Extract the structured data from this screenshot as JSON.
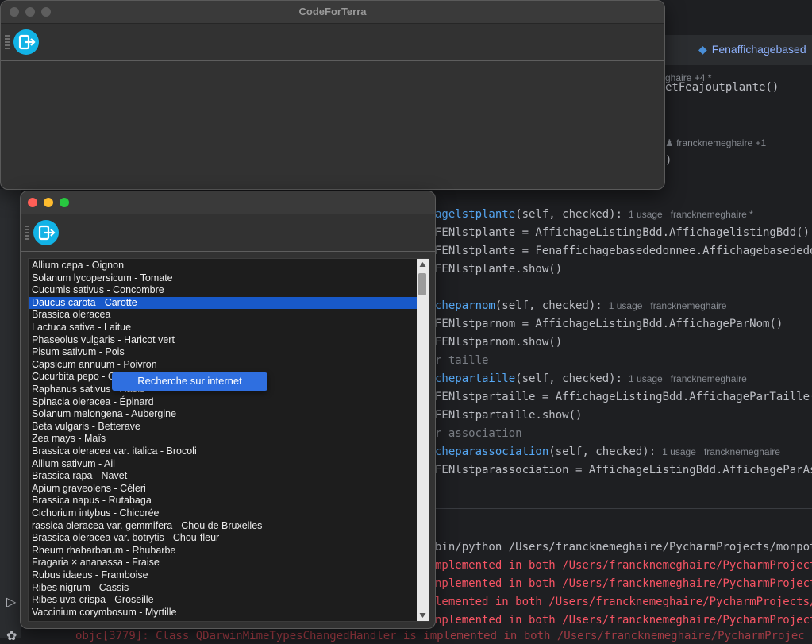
{
  "main_window": {
    "title": "CodeForTerra"
  },
  "list_window": {
    "items": [
      "Allium cepa - Oignon",
      "Solanum lycopersicum - Tomate",
      "Cucumis sativus - Concombre",
      "Daucus carota - Carotte",
      "Brassica oleracea",
      "Lactuca sativa - Laitue",
      "Phaseolus vulgaris - Haricot vert",
      "Pisum sativum - Pois",
      "Capsicum annuum - Poivron",
      "Cucurbita pepo - Courgette",
      "Raphanus sativus - Radis",
      "Spinacia oleracea - Épinard",
      "Solanum melongena - Aubergine",
      "Beta vulgaris - Betterave",
      "Zea mays - Maïs",
      "Brassica oleracea var. italica - Brocoli",
      "Allium sativum - Ail",
      "Brassica rapa - Navet",
      "Apium graveolens - Céleri",
      "Brassica napus - Rutabaga",
      "Cichorium intybus - Chicorée",
      "rassica oleracea var. gemmifera - Chou de Bruxelles",
      "Brassica oleracea var. botrytis - Chou-fleur",
      "Rheum rhabarbarum - Rhubarbe",
      "Fragaria × ananassa - Fraise",
      "Rubus idaeus - Framboise",
      "Ribes nigrum - Cassis",
      "Ribes uva-crispa - Groseille",
      "Vaccinium corymbosum - Myrtille"
    ],
    "selected_index": 3,
    "context_menu": {
      "item": "Recherche sur internet"
    }
  },
  "ide": {
    "tab_title": "Fenaffichagebased",
    "author_hint_1": "ghaire +4 *",
    "author_hint_2": "francknemeghaire +1",
    "code_lines": [
      {
        "pre": "",
        "fn": "agelstplante",
        "args": "(self, checked):",
        "hint": "1 usage   francknemeghaire *"
      },
      {
        "text": "FENlstplante = AffichageListingBdd.AffichagelistingBdd()"
      },
      {
        "text": "FENlstplante = Fenaffichagebasededonnee.Affichagebasededonn"
      },
      {
        "text": "FENlstplante.show()"
      },
      {
        "pre": "",
        "fn": "cheparnom",
        "args": "(self, checked):",
        "hint": "1 usage   francknemeghaire"
      },
      {
        "text": "FENlstparnom = AffichageListingBdd.AffichageParNom()"
      },
      {
        "text": "FENlstparnom.show()"
      },
      {
        "comment": "r taille"
      },
      {
        "pre": "",
        "fn": "chepartaille",
        "args": "(self, checked):",
        "hint": "1 usage   francknemeghaire"
      },
      {
        "text": "FENlstpartaille = AffichageListingBdd.AffichageParTaille()"
      },
      {
        "text": "FENlstpartaille.show()"
      },
      {
        "comment": "r association"
      },
      {
        "pre": "",
        "fn": "cheparassociation",
        "args": "(self, checked):",
        "hint": "1 usage   francknemeghaire"
      },
      {
        "text": "FENlstparassociation = AffichageListingBdd.AffichageParAsso"
      }
    ],
    "run_lines": [
      {
        "text": "bin/python /Users/francknemeghaire/PycharmProjects/monpota",
        "color": "white"
      },
      {
        "text": "mplemented in both /Users/francknemeghaire/PycharmProjects",
        "color": "red"
      },
      {
        "text": "nplemented in both /Users/francknemeghaire/PycharmProjects/",
        "color": "red"
      },
      {
        "text": "lemented in both /Users/francknemeghaire/PycharmProjects/mo",
        "color": "red"
      },
      {
        "text": "nplemented in both /Users/francknemeghaire/PycharmProjects/",
        "color": "red"
      }
    ],
    "bottom_ghost": "objc[3779]: Class QDarwinMimeTypesChangedHandler is implemented in both /Users/francknemeghaire/PycharmProjec"
  }
}
